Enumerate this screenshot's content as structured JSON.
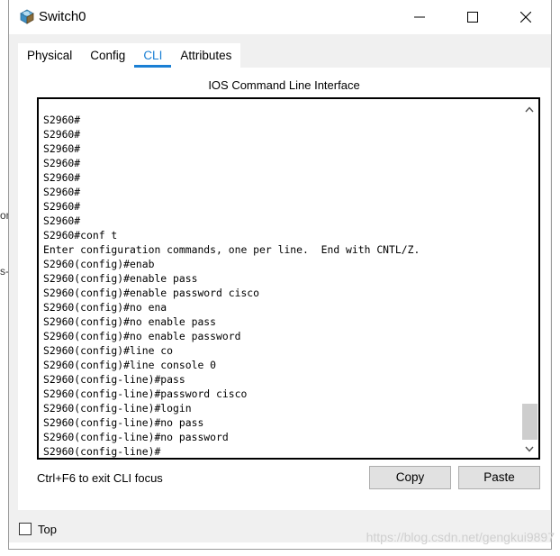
{
  "window": {
    "title": "Switch0"
  },
  "tabs": [
    {
      "label": "Physical",
      "active": false
    },
    {
      "label": "Config",
      "active": false
    },
    {
      "label": "CLI",
      "active": true
    },
    {
      "label": "Attributes",
      "active": false
    }
  ],
  "cli": {
    "title": "IOS Command Line Interface",
    "lines": [
      "S2960#",
      "S2960#",
      "S2960#",
      "S2960#",
      "S2960#",
      "S2960#",
      "S2960#",
      "S2960#",
      "S2960#conf t",
      "Enter configuration commands, one per line.  End with CNTL/Z.",
      "S2960(config)#enab",
      "S2960(config)#enable pass",
      "S2960(config)#enable password cisco",
      "S2960(config)#no ena",
      "S2960(config)#no enable pass",
      "S2960(config)#no enable password",
      "S2960(config)#line co",
      "S2960(config)#line console 0",
      "S2960(config-line)#pass",
      "S2960(config-line)#password cisco",
      "S2960(config-line)#login",
      "S2960(config-line)#no pass",
      "S2960(config-line)#no password",
      "S2960(config-line)#"
    ],
    "hint": "Ctrl+F6 to exit CLI focus",
    "copy_label": "Copy",
    "paste_label": "Paste"
  },
  "footer": {
    "top_label": "Top",
    "top_checked": false
  },
  "watermark": "https://blog.csdn.net/gengkui9897",
  "edge_fragments": [
    "on",
    "s-"
  ],
  "colors": {
    "accent": "#1a7fd4",
    "tab_background": "#f0f0f0",
    "button_background": "#e1e1e1",
    "scroll_thumb": "#cdcdcd"
  },
  "icons": {
    "app": "switch-device-icon",
    "minimize": "minimize-icon",
    "maximize": "maximize-icon",
    "close": "close-icon",
    "scroll_up": "chevron-up-icon",
    "scroll_down": "chevron-down-icon"
  }
}
